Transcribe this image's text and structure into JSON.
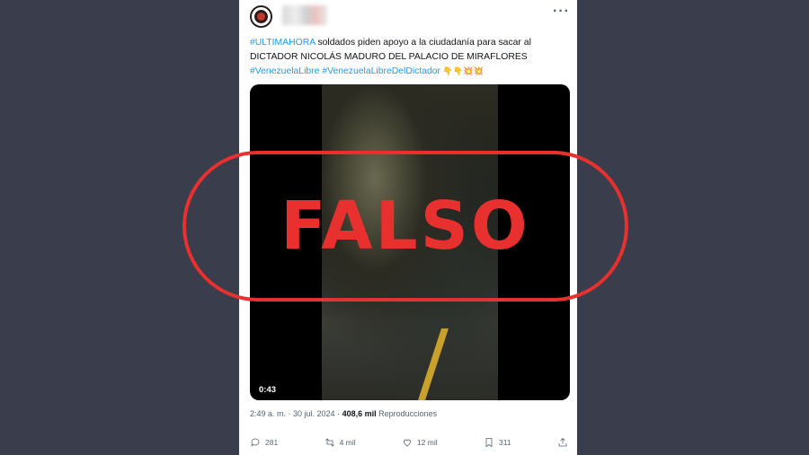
{
  "tweet": {
    "text_parts": {
      "tag1": "#ULTIMAHORA",
      "body": " soldados piden apoyo a la ciudadanía para sacar al DICTADOR NICOLÁS MADURO DEL PALACIO DE MIRAFLORES",
      "tag2": "#VenezuelaLibre",
      "tag3": "#VenezuelaLibreDelDictador",
      "emojis": "👇👇💥💥"
    },
    "video_duration": "0:43",
    "meta": {
      "time": "2:49 a. m. · 30 jul. 2024 · ",
      "views": "408,6 mil",
      "views_label": " Reproducciones"
    },
    "actions": {
      "replies": "281",
      "retweets": "4 mil",
      "likes": "12 mil",
      "bookmarks": "311"
    }
  },
  "overlay": {
    "stamp": "FALSO",
    "color": "#e8302e"
  }
}
